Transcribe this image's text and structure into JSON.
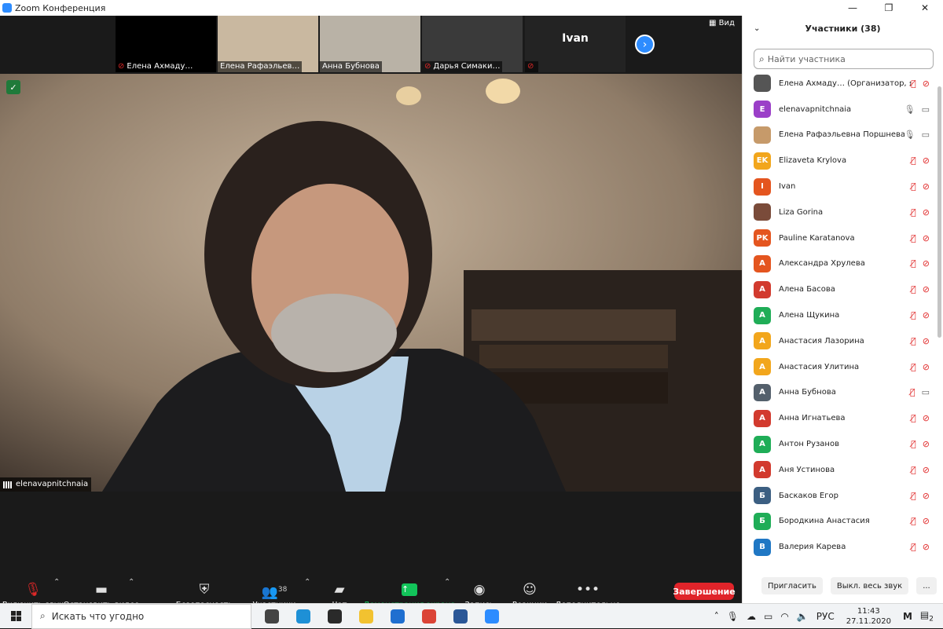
{
  "window": {
    "title": "Zoom Конференция",
    "minimize": "—",
    "maximize": "❐",
    "close": "✕"
  },
  "strip": {
    "thumbnails": [
      {
        "name": "Елена Ахмаду…",
        "muted": true,
        "bg": "#000000"
      },
      {
        "name": "Елена Рафаэльев…",
        "muted": false,
        "bg": "#c9b8a0"
      },
      {
        "name": "Анна Бубнова",
        "muted": false,
        "bg": "#b9b2a6"
      },
      {
        "name": "Дарья Симаки…",
        "muted": true,
        "bg": "#3a3a3a"
      },
      {
        "name": "",
        "center_name": "Ivan",
        "muted": true,
        "bg": "#232323"
      }
    ],
    "view_label": "Вид"
  },
  "speaker": {
    "name": "elenavapnitchnaia"
  },
  "toolbar": {
    "unmute": "Включить звук",
    "stop_video": "Остановить видео",
    "security": "Безопасность",
    "participants": "Участники",
    "participants_count": "38",
    "chat": "Чат",
    "share": "Демонстрация экрана",
    "record": "Запись",
    "reactions": "Реакции",
    "more": "Дополнительно",
    "end": "Завершение"
  },
  "panel": {
    "title": "Участники (38)",
    "search_placeholder": "Найти участника",
    "participants": [
      {
        "initials": "",
        "name": "Елена Ахмаду… (Организатор, я)",
        "color": "#555555",
        "mic": "muted",
        "video": "off",
        "photo": true
      },
      {
        "initials": "E",
        "name": "elenavapnitchnaia",
        "color": "#9b3fc8",
        "mic": "on",
        "video": "on"
      },
      {
        "initials": "",
        "name": "Елена Рафаэльевна Поршнева",
        "color": "#c69a6a",
        "mic": "on",
        "video": "on",
        "photo": true
      },
      {
        "initials": "EK",
        "name": "Elizaveta Krylova",
        "color": "#f2a61c",
        "mic": "muted",
        "video": "off"
      },
      {
        "initials": "I",
        "name": "Ivan",
        "color": "#e4551f",
        "mic": "muted",
        "video": "off"
      },
      {
        "initials": "",
        "name": "Liza Gorina",
        "color": "#7a4b3a",
        "mic": "muted",
        "video": "off",
        "photo": true
      },
      {
        "initials": "PK",
        "name": "Pauline Karatanova",
        "color": "#e4551f",
        "mic": "muted",
        "video": "off"
      },
      {
        "initials": "А",
        "name": "Александра Хрулева",
        "color": "#e4551f",
        "mic": "muted",
        "video": "off"
      },
      {
        "initials": "А",
        "name": "Алена Басова",
        "color": "#d23a2e",
        "mic": "muted",
        "video": "off"
      },
      {
        "initials": "А",
        "name": "Алена Щукина",
        "color": "#1fad57",
        "mic": "muted",
        "video": "off"
      },
      {
        "initials": "А",
        "name": "Анастасия Лазорина",
        "color": "#f2a61c",
        "mic": "muted",
        "video": "off"
      },
      {
        "initials": "А",
        "name": "Анастасия Улитина",
        "color": "#f2a61c",
        "mic": "muted",
        "video": "off"
      },
      {
        "initials": "А",
        "name": "Анна Бубнова",
        "color": "#54606c",
        "mic": "muted",
        "video": "on"
      },
      {
        "initials": "А",
        "name": "Анна Игнатьева",
        "color": "#d23a2e",
        "mic": "muted",
        "video": "off"
      },
      {
        "initials": "А",
        "name": "Антон Рузанов",
        "color": "#1fad57",
        "mic": "muted",
        "video": "off"
      },
      {
        "initials": "А",
        "name": "Аня Устинова",
        "color": "#d23a2e",
        "mic": "muted",
        "video": "off"
      },
      {
        "initials": "Б",
        "name": "Баскаков Егор",
        "color": "#3c5f82",
        "mic": "muted",
        "video": "off"
      },
      {
        "initials": "Б",
        "name": "Бородкина Анастасия",
        "color": "#1fad57",
        "mic": "muted",
        "video": "off"
      },
      {
        "initials": "В",
        "name": "Валерия Карева",
        "color": "#1f77c4",
        "mic": "muted",
        "video": "off"
      }
    ],
    "invite": "Пригласить",
    "mute_all": "Выкл. весь звук",
    "more": "..."
  },
  "taskbar": {
    "search_placeholder": "Искать что угодно",
    "apps": [
      {
        "name": "task-view",
        "color": "#444444"
      },
      {
        "name": "edge",
        "color": "#1e90d6"
      },
      {
        "name": "store",
        "color": "#2a2a2a"
      },
      {
        "name": "explorer",
        "color": "#f2c230"
      },
      {
        "name": "mail",
        "color": "#1f6fd0"
      },
      {
        "name": "chrome",
        "color": "#db4437"
      },
      {
        "name": "word",
        "color": "#2b5797"
      },
      {
        "name": "zoom",
        "color": "#2d8cff"
      }
    ],
    "lang": "РУС",
    "time": "11:43",
    "date": "27.11.2020",
    "notif_count": "2"
  }
}
